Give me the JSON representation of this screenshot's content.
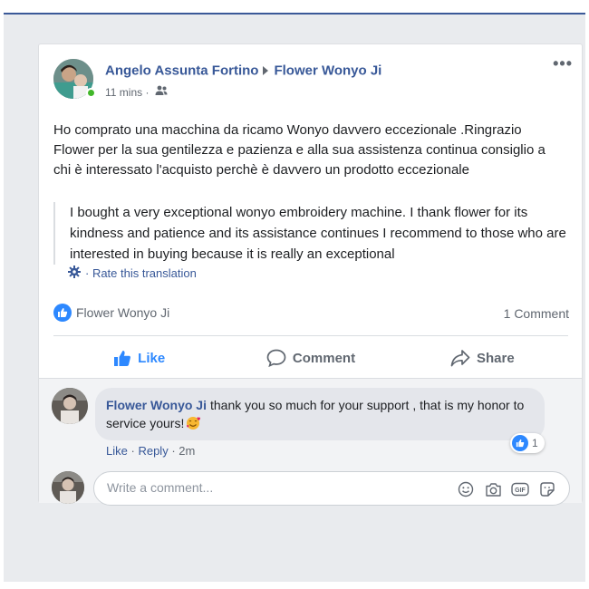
{
  "colors": {
    "link": "#385898",
    "like_blue": "#2d88ff",
    "online": "#42b72a",
    "secondary_text": "#606770"
  },
  "post": {
    "author": "Angelo Assunta Fortino",
    "target": "Flower Wonyo Ji",
    "time": "11 mins",
    "separator": "·",
    "audience_icon": "friends-icon",
    "more_label": "•••",
    "body": "Ho comprato una macchina da ricamo Wonyo davvero eccezionale .Ringrazio Flower per la sua gentilezza e pazienza e alla sua assistenza continua consiglio a chi è interessato l'acquisto perchè è davvero un prodotto eccezionale",
    "translation": "I bought a very exceptional wonyo embroidery machine. I thank flower for its kindness and patience and its assistance continues I recommend to those who are interested in buying because it is really an exceptional",
    "rate_translation": "· Rate this translation",
    "reactions_by": "Flower Wonyo Ji",
    "comment_count": "1 Comment"
  },
  "actions": {
    "like": "Like",
    "comment": "Comment",
    "share": "Share"
  },
  "comment": {
    "author": "Flower Wonyo Ji",
    "text": "thank you so much for your support , that is my honor to service yours!",
    "emoji": "smiling-face-with-hearts-icon",
    "reaction_count": "1",
    "like_label": "Like",
    "reply_label": "Reply",
    "time": "2m",
    "separator": "·"
  },
  "composer": {
    "placeholder": "Write a comment..."
  }
}
